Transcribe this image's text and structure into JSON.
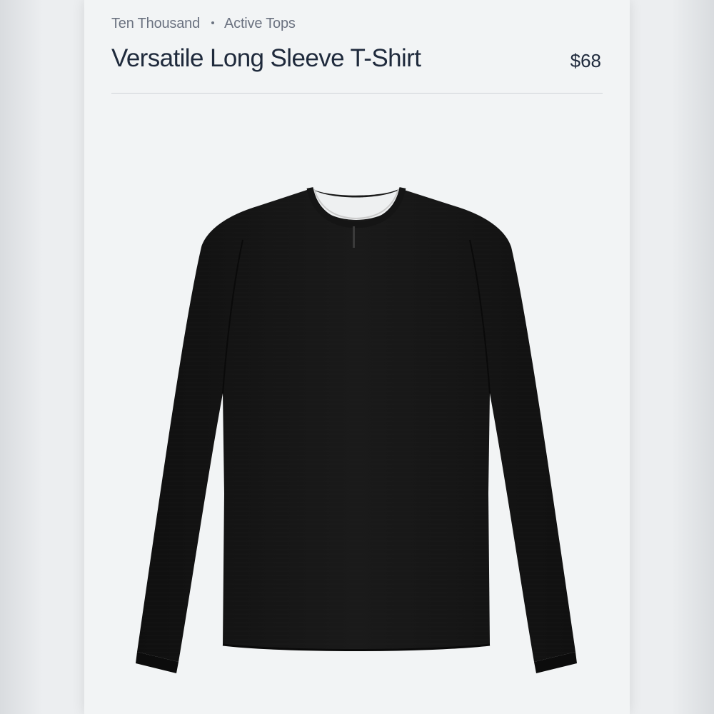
{
  "breadcrumb": {
    "brand": "Ten Thousand",
    "category": "Active Tops"
  },
  "product": {
    "title": "Versatile Long Sleeve T-Shirt",
    "price": "$68",
    "image_alt": "Black long sleeve crew-neck t-shirt",
    "color": "#151515"
  },
  "colors": {
    "background": "#f2f4f5",
    "title_text": "#1f2a3c",
    "muted_text": "#6b7280",
    "divider": "#cfd3d7"
  }
}
